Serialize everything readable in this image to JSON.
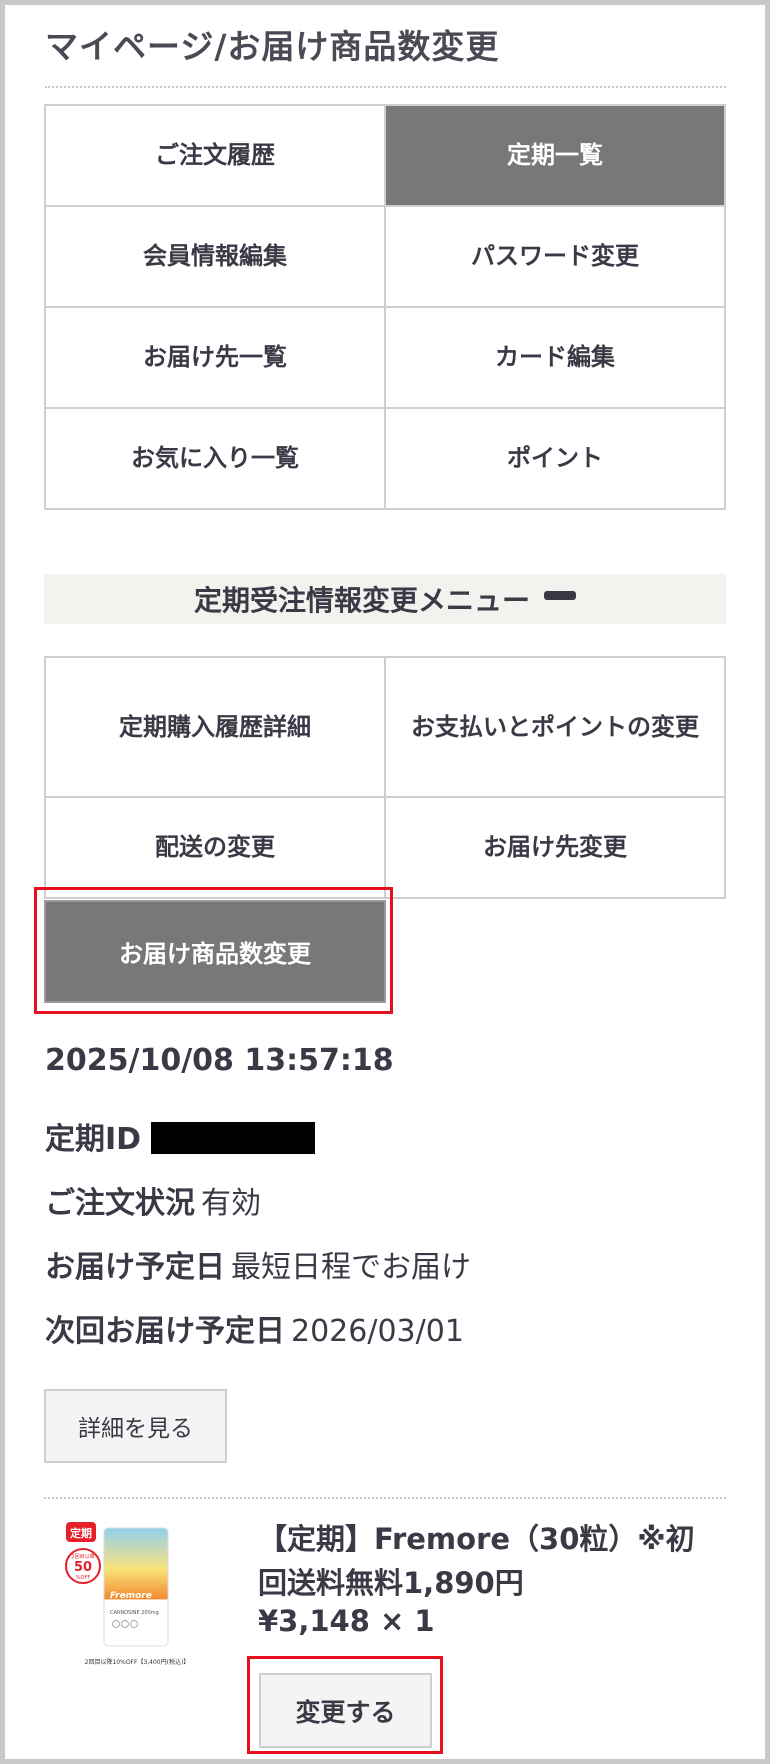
{
  "page": {
    "title": "マイページ/お届け商品数変更"
  },
  "menu": {
    "items": [
      {
        "label": "ご注文履歴",
        "active": false
      },
      {
        "label": "定期一覧",
        "active": true
      },
      {
        "label": "会員情報編集",
        "active": false
      },
      {
        "label": "パスワード変更",
        "active": false
      },
      {
        "label": "お届け先一覧",
        "active": false
      },
      {
        "label": "カード編集",
        "active": false
      },
      {
        "label": "お気に入り一覧",
        "active": false
      },
      {
        "label": "ポイント",
        "active": false
      }
    ]
  },
  "subscription_menu": {
    "heading": "定期受注情報変更メニュー",
    "toggle_icon": "minus-icon",
    "items": [
      {
        "label": "定期購入履歴詳細"
      },
      {
        "label": "お支払いとポイントの変更"
      },
      {
        "label": "配送の変更"
      },
      {
        "label": "お届け先変更"
      },
      {
        "label": "お届け商品数変更",
        "active": true
      }
    ]
  },
  "order": {
    "datetime": "2025/10/08 13:57:18",
    "id_label": "定期ID",
    "status_label": "ご注文状況",
    "status_value": "有効",
    "delivery_label": "お届け予定日",
    "delivery_value": "最短日程でお届け",
    "next_label": "次回お届け予定日",
    "next_value": "2026/03/01",
    "detail_button": "詳細を見る"
  },
  "product": {
    "image_badge": "定期",
    "image_discount_top": "2回目以降",
    "image_discount_num": "50",
    "image_discount_unit": "%OFF",
    "image_brand": "Fremore",
    "image_subtitle": "CARNOSINE 200mg",
    "image_caption": "2回目以降10%OFF【3,400円(税込)】",
    "name": "【定期】Fremore（30粒）※初回送料無料1,890円",
    "price": "¥3,148 × 1",
    "change_button": "変更する"
  },
  "colors": {
    "active_bg": "#787878",
    "highlight": "#e8101e",
    "text": "#3a3a46",
    "border": "#cfcfcf"
  }
}
